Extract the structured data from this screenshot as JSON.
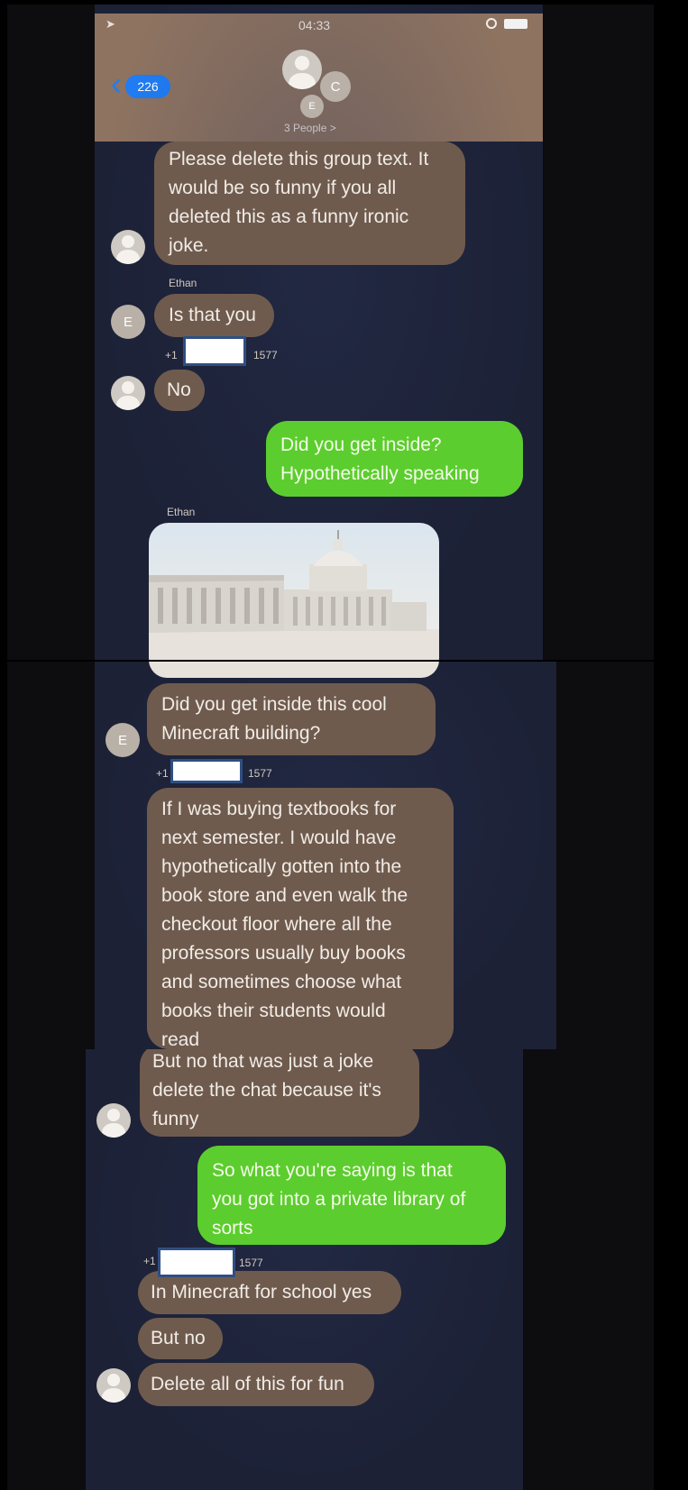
{
  "status": {
    "time": "04:33"
  },
  "header": {
    "back_count": "226",
    "group_label": "3 People >",
    "avatar_letter_1": "E",
    "avatar_letter_2": "C"
  },
  "messages": {
    "m1": [
      "Please delete this group text. It",
      "would be so funny if you all",
      "deleted this as a funny ironic",
      "joke."
    ],
    "sender_ethan": "Ethan",
    "m2": "Is that you",
    "phone_prefix": "+1",
    "phone_suffix": "1577",
    "m3": "No",
    "m4": [
      "Did you get inside?",
      "Hypothetically speaking"
    ],
    "m6": [
      "Did you get inside this cool",
      "Minecraft building?"
    ],
    "m7": [
      "If I was buying textbooks for",
      "next semester. I would have",
      "hypothetically gotten into the",
      "book store and even walk the",
      "checkout floor where all the",
      "professors usually buy books",
      "and sometimes choose what",
      "books their students would",
      "read"
    ],
    "m8": [
      "But no that was just a joke",
      "delete the chat because it's",
      "funny"
    ],
    "m9": [
      "So what you're saying is that",
      "you got into a private library of",
      "sorts"
    ],
    "m10": "In Minecraft for school yes",
    "m11": "But no",
    "m12": "Delete all of this for fun"
  },
  "avatars": {
    "e_letter": "E"
  },
  "colors": {
    "incoming": "#6f5b4e",
    "outgoing": "#5ccd2e",
    "accent": "#1f7df5"
  }
}
